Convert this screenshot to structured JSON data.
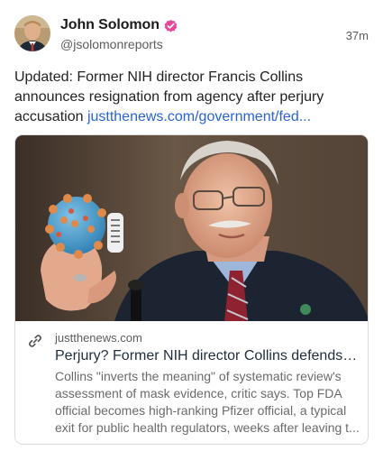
{
  "post": {
    "author": {
      "name": "John Solomon",
      "handle": "@jsolomonreports",
      "verified": true,
      "badge_color": "#ec4899"
    },
    "timestamp": "37m",
    "text": "Updated: Former NIH director Francis Collins announces resignation from agency after perjury accusation ",
    "link_text": "justthenews.com/government/fed..."
  },
  "link_card": {
    "domain": "justthenews.com",
    "title": "Perjury? Former NIH director Collins defends C...",
    "description": "Collins \"inverts the meaning\" of systematic review's assessment of mask evidence, critic says. Top FDA official becomes high-ranking Pfizer official, a typical exit for public health regulators, weeks after leaving t..."
  },
  "colors": {
    "link": "#2a63d8",
    "text_secondary": "#5c5c5c",
    "card_border": "#dcdcdc"
  }
}
